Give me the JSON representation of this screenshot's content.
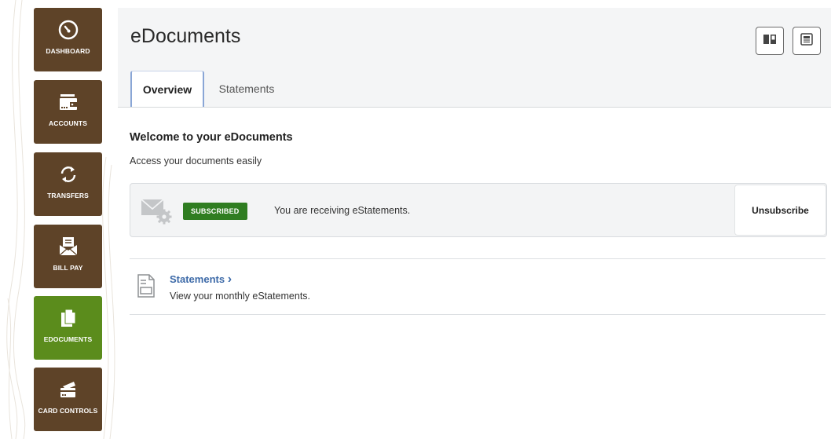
{
  "sidebar": {
    "items": [
      {
        "label": "DASHBOARD",
        "icon": "speedometer-icon",
        "active": false
      },
      {
        "label": "ACCOUNTS",
        "icon": "wallet-icon",
        "active": false
      },
      {
        "label": "TRANSFERS",
        "icon": "transfer-arrows-icon",
        "active": false
      },
      {
        "label": "BILL PAY",
        "icon": "bill-envelope-icon",
        "active": false
      },
      {
        "label": "EDOCUMENTS",
        "icon": "document-icon",
        "active": true
      },
      {
        "label": "CARD CONTROLS",
        "icon": "card-controls-icon",
        "active": false
      }
    ]
  },
  "header": {
    "title": "eDocuments",
    "buttons": [
      {
        "icon": "book-icon"
      },
      {
        "icon": "newspaper-icon"
      }
    ]
  },
  "tabs": [
    {
      "label": "Overview",
      "active": true
    },
    {
      "label": "Statements",
      "active": false
    }
  ],
  "welcome": {
    "title": "Welcome to your eDocuments",
    "subtitle": "Access your documents easily"
  },
  "subscription": {
    "icon": "mail-settings-icon",
    "badge": "SUBSCRIBED",
    "message": "You are receiving eStatements.",
    "button_label": "Unsubscribe"
  },
  "statements": {
    "icon": "statement-document-icon",
    "link_label": "Statements",
    "chevron": "›",
    "description": "View your monthly eStatements."
  },
  "colors": {
    "nav_brown": "#5e4328",
    "nav_active_green": "#5b8c1c",
    "badge_green": "#2f7d21",
    "link_blue": "#3d6aa8"
  }
}
